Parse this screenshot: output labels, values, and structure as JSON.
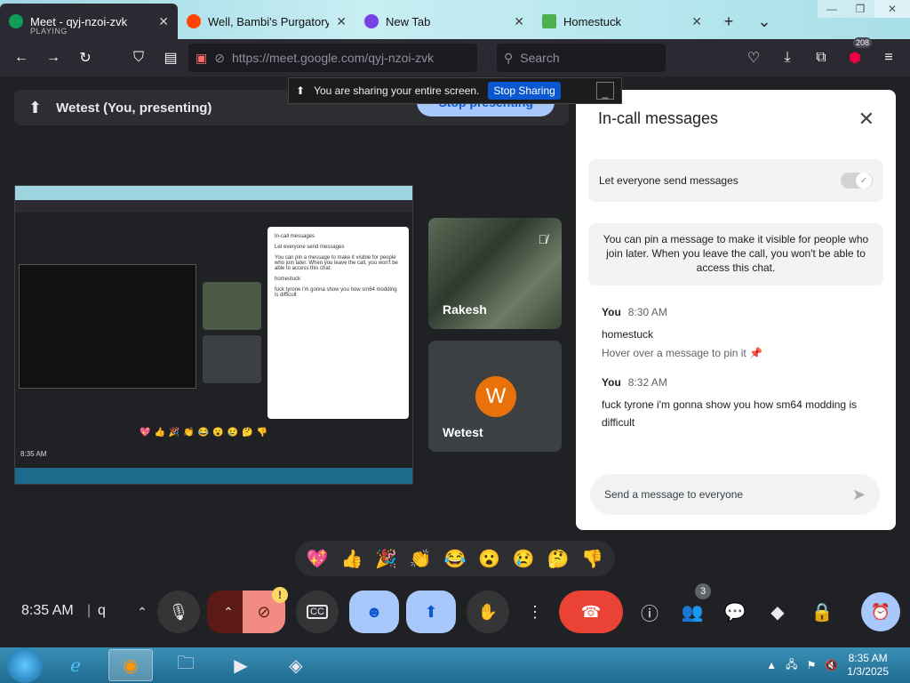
{
  "tabs": [
    {
      "title": "Meet - qyj-nzoi-zvk",
      "sub": "PLAYING",
      "fav_color": "#0f9d58",
      "active": true
    },
    {
      "title": "Well, Bambi's Purgatory is",
      "fav_color": "#ff4500"
    },
    {
      "title": "New Tab",
      "fav_color": "#7542e5"
    },
    {
      "title": "Homestuck",
      "fav_color": "#4caf50"
    }
  ],
  "nav": {
    "url": "https://meet.google.com/qyj-nzoi-zvk",
    "search_placeholder": "Search",
    "extensions_badge": "208"
  },
  "sharebar": {
    "text": "You are sharing your entire screen.",
    "stop_label": "Stop Sharing"
  },
  "presenting": {
    "title": "Wetest (You, presenting)",
    "stop_label": "Stop presenting"
  },
  "participants": [
    {
      "name": "Rakesh"
    },
    {
      "name": "Wetest",
      "initial": "W"
    }
  ],
  "chat": {
    "title": "In-call messages",
    "let_everyone": "Let everyone send messages",
    "pin_info": "You can pin a message to make it visible for people who join later. When you leave the call, you won't be able to access this chat.",
    "messages": [
      {
        "sender": "You",
        "time": "8:30 AM",
        "text": "homestuck",
        "hint": "Hover over a message to pin it"
      },
      {
        "sender": "You",
        "time": "8:32 AM",
        "text": "fuck tyrone i'm gonna show you how sm64 modding is difficult"
      }
    ],
    "input_placeholder": "Send a message to everyone"
  },
  "reactions": [
    "💖",
    "👍",
    "🎉",
    "👏",
    "😂",
    "😮",
    "😢",
    "🤔",
    "👎"
  ],
  "controls": {
    "time": "8:35 AM",
    "separator": "|",
    "code_initial": "q",
    "warning": "!",
    "people_count": "3"
  },
  "taskbar": {
    "time": "8:35 AM",
    "date": "1/3/2025"
  }
}
